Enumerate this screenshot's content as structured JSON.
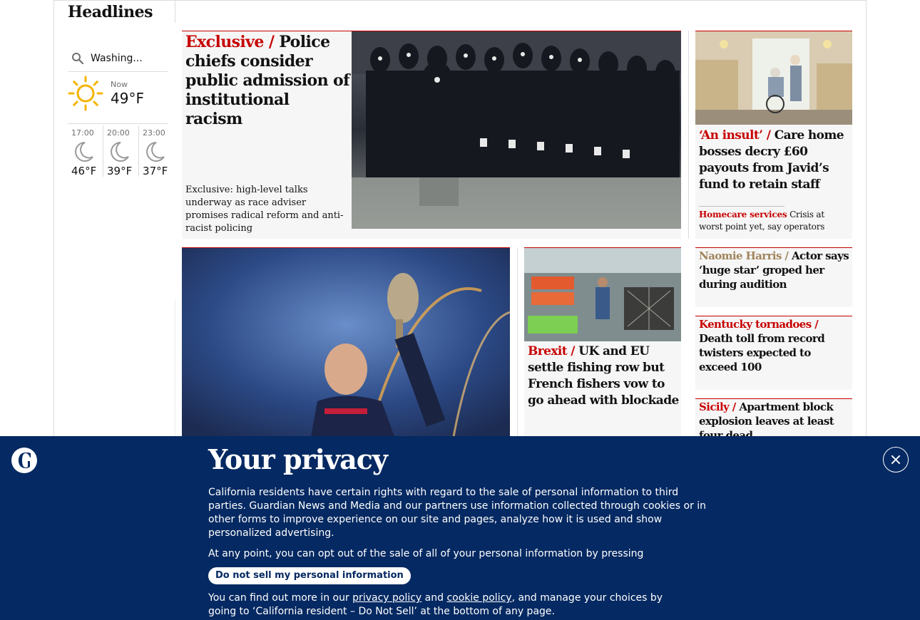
{
  "section": {
    "title": "Headlines"
  },
  "weather": {
    "location": "Washing...",
    "now_label": "Now",
    "now_temp": "49°F",
    "now_icon": "sun-icon",
    "forecast": [
      {
        "time": "17:00",
        "temp": "46°F",
        "icon": "moon-icon"
      },
      {
        "time": "20:00",
        "temp": "39°F",
        "icon": "moon-icon"
      },
      {
        "time": "23:00",
        "temp": "37°F",
        "icon": "moon-icon"
      }
    ]
  },
  "stories": {
    "lead": {
      "kicker": "Exclusive /",
      "headline": "Police chiefs consider public admission of institutional racism",
      "standfirst": "Exclusive: high-level talks underway as race adviser promises radical reform and anti-racist policing"
    },
    "care": {
      "kicker": "‘An insult’ /",
      "headline": "Care home bosses decry £60 payouts from Javid’s fund to retain staff",
      "sublink_kicker": "Homecare services",
      "sublink_text": "Crisis at worst point yet, say operators"
    },
    "brexit": {
      "kicker": "Brexit /",
      "headline": "UK and EU settle fishing row but French fishers vow to go ahead with blockade"
    },
    "naomie": {
      "kicker": "Naomie Harris  /",
      "headline": "Actor says ‘huge star’ groped her during audition"
    },
    "kentucky": {
      "kicker": "Kentucky tornadoes /",
      "headline": "Death toll from record twisters expected to exceed 100"
    },
    "sicily": {
      "kicker": "Sicily /",
      "headline": "Apartment block explosion leaves at least four dead"
    }
  },
  "privacy": {
    "title": "Your privacy",
    "p1": "California residents have certain rights with regard to the sale of personal information to third parties. Guardian News and Media and our partners use information collected through cookies or in other forms to improve experience on our site and pages, analyze how it is used and show personalized advertising.",
    "p2": "At any point, you can opt out of the sale of all of your personal information by pressing",
    "button": "Do not sell my personal information",
    "p3_a": "You can find out more in our ",
    "link_privacy": "privacy policy",
    "p3_and": " and ",
    "link_cookie": "cookie policy",
    "p3_b": ", and manage your choices by going to ‘California resident – Do Not Sell’ at the bottom of any page."
  },
  "colors": {
    "news_red": "#c70000",
    "guardian_blue": "#052962",
    "culture_gold": "#a1845c"
  }
}
